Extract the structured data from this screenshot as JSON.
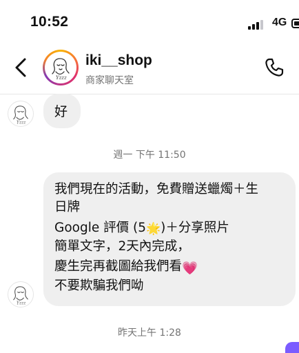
{
  "status_bar": {
    "time": "10:52",
    "network": "4G",
    "signal_level": 3,
    "signal_max": 4
  },
  "header": {
    "shop_name": "iki__shop",
    "subtitle": "商家聊天室",
    "back_icon": "chevron-left-icon",
    "call_icon": "phone-icon",
    "brand_ring_colors": [
      "#f8b400",
      "#e1306c",
      "#833ab4"
    ]
  },
  "messages": [
    {
      "type": "received",
      "text": "好"
    },
    {
      "type": "timestamp",
      "text": "週一 下午 11:50"
    },
    {
      "type": "received",
      "lines": [
        "我們現在的活動，免費贈送蠟燭＋生",
        "日牌",
        "Google 評價 (5",
        "🌟",
        ")＋分享照片",
        "簡單文字，2天內完成，",
        "慶生完再截圖給我們看",
        "💗",
        "不要欺騙我們呦"
      ]
    },
    {
      "type": "timestamp",
      "text": "昨天上午 1:28"
    }
  ],
  "colors": {
    "bubble_bg": "#efefef",
    "meta_text": "#737373",
    "outgoing_bubble": "#7b5cff"
  }
}
